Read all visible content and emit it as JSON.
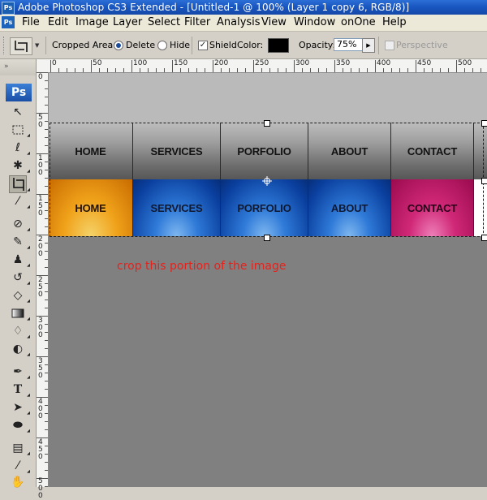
{
  "titlebar": {
    "title": "Adobe Photoshop CS3 Extended - [Untitled-1 @ 100% (Layer 1 copy 6, RGB/8)]",
    "icon_label": "Ps"
  },
  "menubar": {
    "logo_label": "Ps",
    "items": [
      "File",
      "Edit",
      "Image",
      "Layer",
      "Select",
      "Filter",
      "Analysis",
      "View",
      "Window",
      "onOne",
      "Help"
    ]
  },
  "options": {
    "cropped_area_label": "Cropped Area:",
    "delete_label": "Delete",
    "hide_label": "Hide",
    "shield_label": "Shield",
    "color_label": "Color:",
    "opacity_label": "Opacity:",
    "opacity_value": "75%",
    "perspective_label": "Perspective",
    "shield_color": "#000000"
  },
  "toolbox": {
    "badge": "Ps"
  },
  "ruler": {
    "h_labels": [
      "0",
      "50",
      "100",
      "150",
      "200",
      "250",
      "300",
      "350",
      "400",
      "450",
      "500"
    ],
    "v_labels": [
      "0",
      "50",
      "100",
      "150",
      "200",
      "250",
      "300",
      "350",
      "400",
      "450",
      "500"
    ]
  },
  "canvas": {
    "gray_row": [
      "HOME",
      "SERVICES",
      "PORFOLIO",
      "ABOUT",
      "CONTACT"
    ],
    "color_row": [
      "HOME",
      "SERVICES",
      "PORFOLIO",
      "ABOUT",
      "CONTACT"
    ],
    "note": "crop this portion of the image",
    "note_color": "#e8201a"
  }
}
